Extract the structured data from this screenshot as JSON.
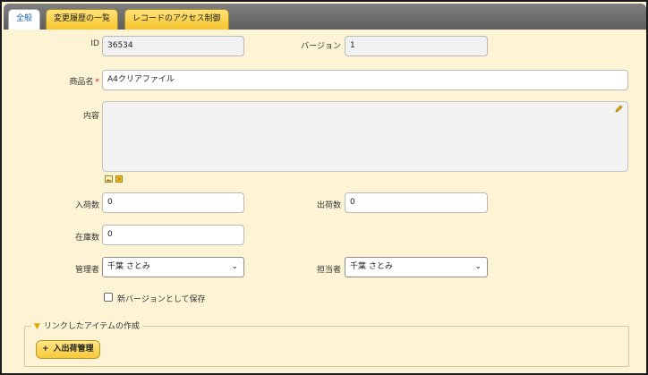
{
  "tabs": [
    {
      "label": "全般"
    },
    {
      "label": "変更履歴の一覧"
    },
    {
      "label": "レコードのアクセス制御"
    }
  ],
  "form": {
    "id_label": "ID",
    "id_value": "36534",
    "version_label": "バージョン",
    "version_value": "1",
    "name_label": "商品名",
    "name_required": "*",
    "name_value": "A4クリアファイル",
    "content_label": "内容",
    "content_value": "",
    "incoming_label": "入荷数",
    "incoming_value": "0",
    "outgoing_label": "出荷数",
    "outgoing_value": "0",
    "stock_label": "在庫数",
    "stock_value": "0",
    "manager_label": "管理者",
    "manager_selected": "千葉 さとみ",
    "assignee_label": "担当者",
    "assignee_selected": "千葉 さとみ",
    "new_version_label": "新バージョンとして保存",
    "new_version_checked": false
  },
  "linked": {
    "legend": "リンクしたアイテムの作成",
    "button_label": "入出荷管理",
    "button_icon": "+"
  },
  "colors": {
    "panel_bg": "#fdf4d6",
    "tab_active_text": "#1a66b8",
    "tab_bg": "#f6c42c",
    "required": "#d11111"
  }
}
